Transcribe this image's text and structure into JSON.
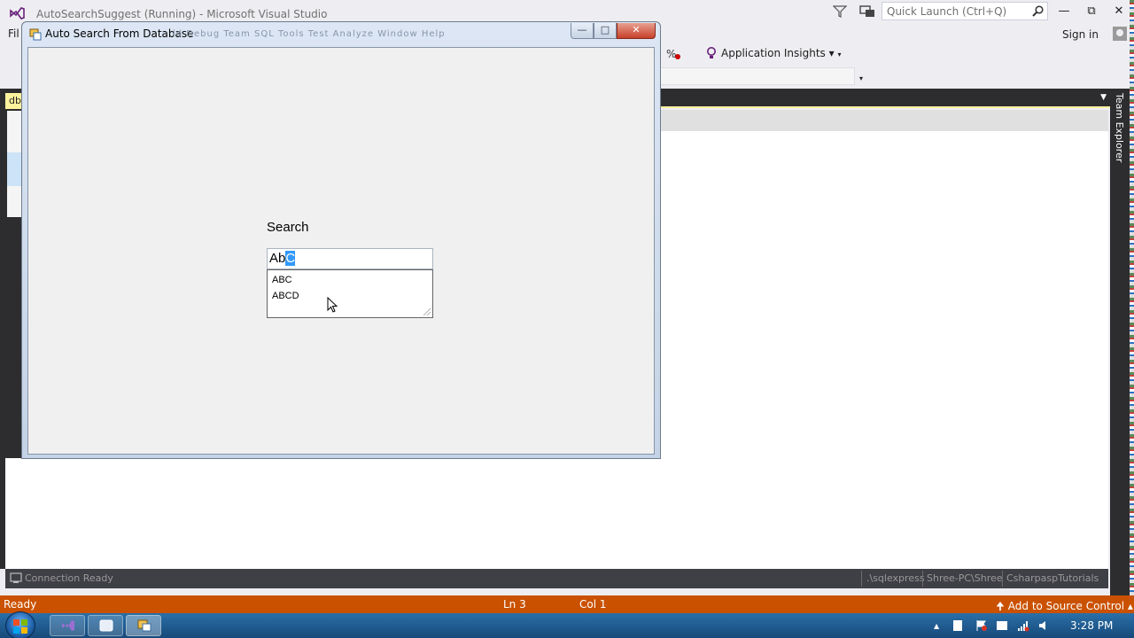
{
  "vs": {
    "title": "AutoSearchSuggest (Running) - Microsoft Visual Studio",
    "quick_launch_placeholder": "Quick Launch (Ctrl+Q)",
    "menu_file": "Fil",
    "sign_in": "Sign in",
    "application_insights": "Application Insights",
    "db_tab": "db",
    "team_explorer": "Team Explorer"
  },
  "output_bar": {
    "connection": "Connection Ready",
    "server": ".\\sqlexpress",
    "user": "Shree-PC\\Shree",
    "database": "CsharpaspTutorials"
  },
  "status": {
    "ready": "Ready",
    "line": "Ln 3",
    "col": "Col 1",
    "source_control": "Add to Source Control"
  },
  "taskbar": {
    "clock": "3:28 PM"
  },
  "form": {
    "title": "Auto Search From Database",
    "ghost_menu": "ld   Debug   Team   SQL   Tools   Test   Analyze   Window   Help",
    "search_label": "Search",
    "input_typed": "Ab",
    "input_selected": "C",
    "suggestions": [
      "ABC",
      "ABCD"
    ]
  },
  "colors": {
    "status_bar": "#ca5100",
    "selection": "#3399ff",
    "vs_dark": "#2d2d30",
    "tab_highlight": "#fff29d"
  }
}
